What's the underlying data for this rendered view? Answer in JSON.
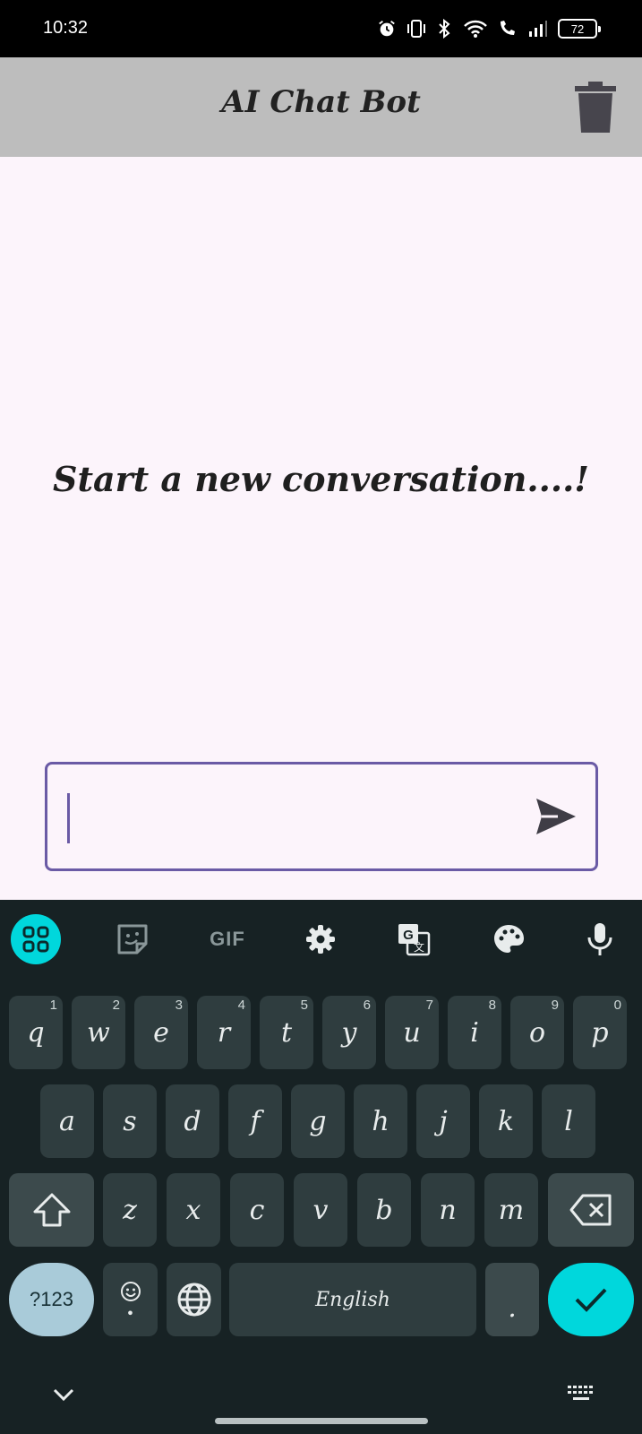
{
  "status_bar": {
    "time": "10:32",
    "battery": "72"
  },
  "app_bar": {
    "title": "AI Chat Bot"
  },
  "main": {
    "empty_message": "Start a new conversation....!"
  },
  "composer": {
    "value": ""
  },
  "keyboard": {
    "toolbar": {
      "gif_label": "GIF"
    },
    "rows": [
      [
        {
          "c": "q",
          "h": "1"
        },
        {
          "c": "w",
          "h": "2"
        },
        {
          "c": "e",
          "h": "3"
        },
        {
          "c": "r",
          "h": "4"
        },
        {
          "c": "t",
          "h": "5"
        },
        {
          "c": "y",
          "h": "6"
        },
        {
          "c": "u",
          "h": "7"
        },
        {
          "c": "i",
          "h": "8"
        },
        {
          "c": "o",
          "h": "9"
        },
        {
          "c": "p",
          "h": "0"
        }
      ],
      [
        {
          "c": "a"
        },
        {
          "c": "s"
        },
        {
          "c": "d"
        },
        {
          "c": "f"
        },
        {
          "c": "g"
        },
        {
          "c": "h"
        },
        {
          "c": "j"
        },
        {
          "c": "k"
        },
        {
          "c": "l"
        }
      ],
      [
        {
          "c": "z"
        },
        {
          "c": "x"
        },
        {
          "c": "c"
        },
        {
          "c": "v"
        },
        {
          "c": "b"
        },
        {
          "c": "n"
        },
        {
          "c": "m"
        }
      ]
    ],
    "numbers_key": "?123",
    "space_label": "English",
    "period_key": "."
  },
  "colors": {
    "accent": "#00d7dc",
    "input_border": "#6a5aa5",
    "app_bar": "#bdbdbd"
  }
}
